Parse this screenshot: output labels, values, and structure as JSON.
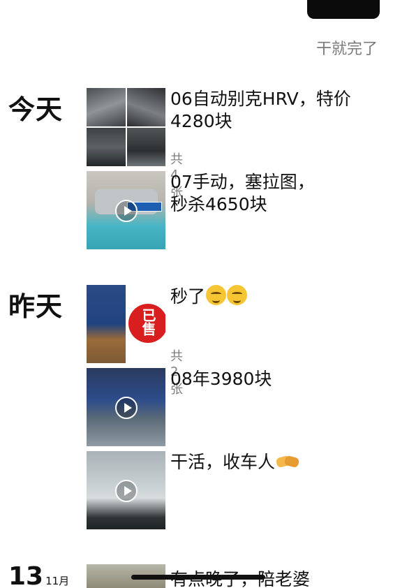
{
  "header": {
    "signature": "干就完了"
  },
  "sections": {
    "today": {
      "label": "今天",
      "posts": [
        {
          "text": "06自动别克HRV，特价4280块",
          "count": "共4张"
        },
        {
          "text": "07手动，塞拉图，秒杀4650块"
        }
      ]
    },
    "yesterday": {
      "label": "昨天",
      "posts": [
        {
          "text": "秒了",
          "count": "共2张",
          "stamp": "已售"
        },
        {
          "text": "08年3980块"
        },
        {
          "text": "干活，收车人"
        }
      ]
    },
    "nov13": {
      "day": "13",
      "month": "11月",
      "posts": [
        {
          "text": "有点晚了，陪老婆"
        }
      ]
    }
  },
  "icons": {
    "play": "play-icon",
    "emoji": "smiling-face-icon",
    "handshake": "handshake-icon"
  }
}
